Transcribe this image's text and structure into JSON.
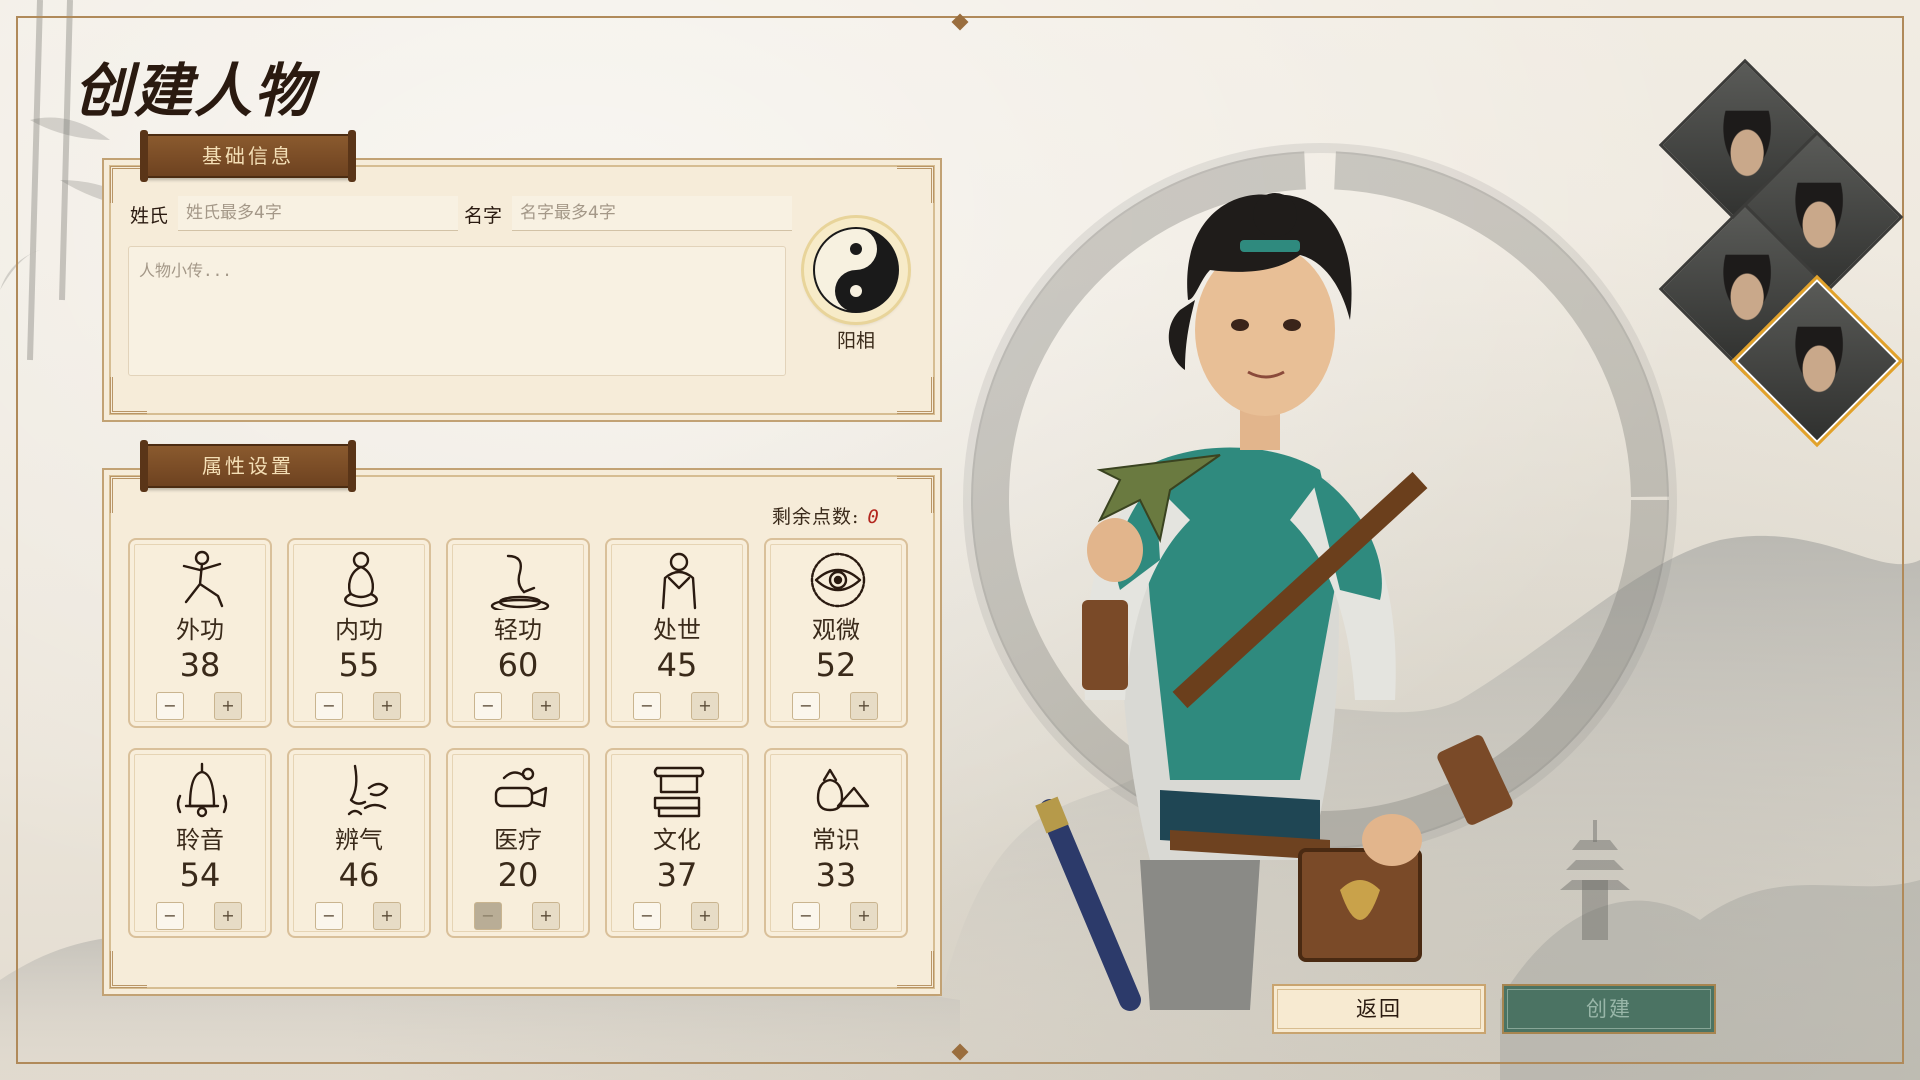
{
  "title": "创建人物",
  "basic_info": {
    "header": "基础信息",
    "surname_label": "姓氏",
    "surname_placeholder": "姓氏最多4字",
    "surname_value": "",
    "given_name_label": "名字",
    "given_name_placeholder": "名字最多4字",
    "given_name_value": "",
    "bio_placeholder": "人物小传...",
    "bio_value": "",
    "aspect_label": "阳相",
    "aspect_icon": "yin-yang-icon"
  },
  "attributes": {
    "header": "属性设置",
    "remaining_label": "剩余点数:",
    "remaining_value": "0",
    "items": [
      {
        "name": "外功",
        "value": "38",
        "icon": "martial-stance-icon",
        "minus": "−",
        "plus": "+"
      },
      {
        "name": "内功",
        "value": "55",
        "icon": "meditation-icon",
        "minus": "−",
        "plus": "+"
      },
      {
        "name": "轻功",
        "value": "60",
        "icon": "leap-icon",
        "minus": "−",
        "plus": "+"
      },
      {
        "name": "处世",
        "value": "45",
        "icon": "bow-salute-icon",
        "minus": "−",
        "plus": "+"
      },
      {
        "name": "观微",
        "value": "52",
        "icon": "eye-icon",
        "minus": "−",
        "plus": "+"
      },
      {
        "name": "聆音",
        "value": "54",
        "icon": "bell-icon",
        "minus": "−",
        "plus": "+"
      },
      {
        "name": "辨气",
        "value": "46",
        "icon": "nose-scent-icon",
        "minus": "−",
        "plus": "+"
      },
      {
        "name": "医疗",
        "value": "20",
        "icon": "bandage-icon",
        "minus": "−",
        "plus": "+"
      },
      {
        "name": "文化",
        "value": "37",
        "icon": "scroll-books-icon",
        "minus": "−",
        "plus": "+"
      },
      {
        "name": "常识",
        "value": "33",
        "icon": "pouch-hat-icon",
        "minus": "−",
        "plus": "+"
      }
    ]
  },
  "portraits": [
    "portrait-1",
    "portrait-2",
    "portrait-3",
    "portrait-4"
  ],
  "selected_portrait": 3,
  "buttons": {
    "back": "返回",
    "create": "创建"
  },
  "colors": {
    "accent_gold": "#e2a22a",
    "teal": "#2f8a7e",
    "ribbon": "#7a4c26",
    "remaining_red": "#b3261e"
  }
}
